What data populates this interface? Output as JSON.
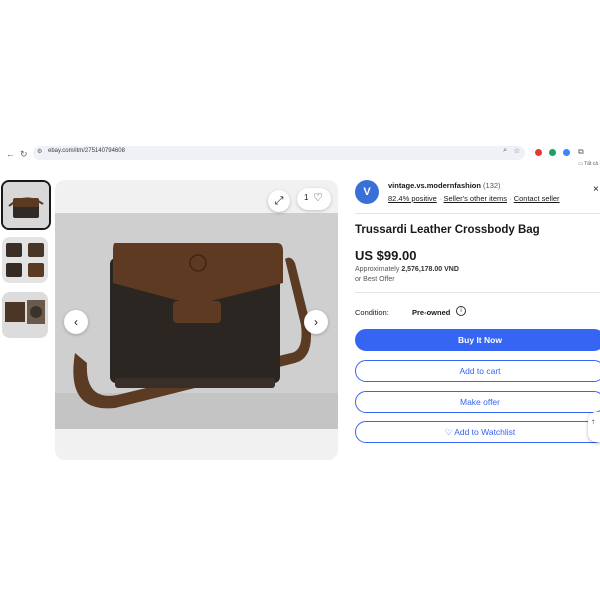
{
  "browser": {
    "url": "ebay.com/itm/275140794608",
    "bookmark_folder": "Tất cả"
  },
  "gallery": {
    "thumbnail_count": 3,
    "watch_count": "1"
  },
  "seller": {
    "avatar_letter": "V",
    "name": "vintage.vs.modernfashion",
    "feedback_count": "(132)",
    "positive": "82.4% positive",
    "other_items": "Seller's other items",
    "contact": "Contact seller"
  },
  "listing": {
    "title": "Trussardi Leather Crossbody Bag",
    "price": "US $99.00",
    "approx_label": "Approximately",
    "approx_value": "2,576,178.00 VND",
    "best_offer": "or Best Offer",
    "condition_label": "Condition:",
    "condition_value": "Pre-owned"
  },
  "actions": {
    "buy_now": "Buy It Now",
    "add_to_cart": "Add to cart",
    "make_offer": "Make offer",
    "watchlist": "♡ Add to Watchlist"
  },
  "colors": {
    "accent": "#3665f3",
    "avatar": "#3b6fd8"
  }
}
